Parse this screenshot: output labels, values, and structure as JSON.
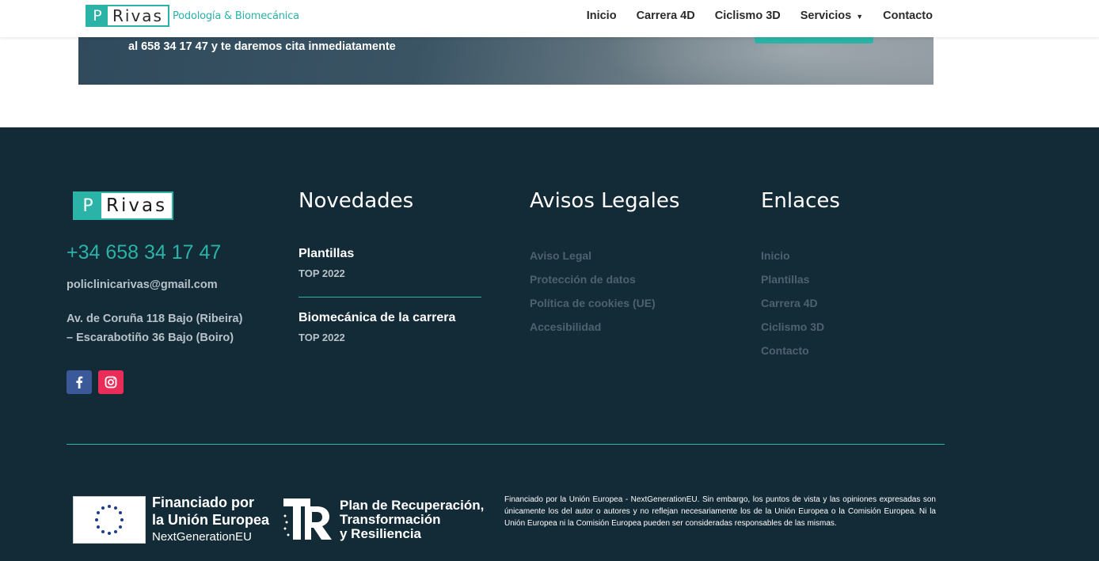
{
  "header": {
    "logo_letter": "P",
    "logo_name": "Rivas",
    "logo_tagline": "Podología & Biomecánica",
    "nav": [
      {
        "label": "Inicio"
      },
      {
        "label": "Carrera 4D"
      },
      {
        "label": "Ciclismo 3D"
      },
      {
        "label": "Servicios"
      },
      {
        "label": "Contacto"
      }
    ]
  },
  "hero": {
    "text": "al 658 34 17 47 y te daremos cita inmediatamente"
  },
  "footer": {
    "logo_letter": "P",
    "logo_name": "Rivas",
    "phone": "+34 658 34 17 47",
    "email": "policlinicarivas@gmail.com",
    "address_line1": "Av. de Coruña 118 Bajo (Ribeira)",
    "address_line2": "– Escarabotiño 36 Bajo (Boiro)",
    "news": {
      "title": "Novedades",
      "items": [
        {
          "title": "Plantillas",
          "meta": "TOP 2022"
        },
        {
          "title": "Biomecánica de la carrera",
          "meta": "TOP 2022"
        }
      ]
    },
    "legal": {
      "title": "Avisos Legales",
      "links": [
        "Aviso Legal",
        "Protección de datos",
        "Política de cookies (UE)",
        "Accesibilidad"
      ]
    },
    "links": {
      "title": "Enlaces",
      "links": [
        "Inicio",
        "Plantillas",
        "Carrera 4D",
        "Ciclismo 3D",
        "Contacto"
      ]
    },
    "eu": {
      "line1": "Financiado por",
      "line2": "la Unión Europea",
      "line3": "NextGenerationEU",
      "plan1": "Plan de Recuperación,",
      "plan2": "Transformación",
      "plan3": "y Resiliencia",
      "disclaimer": "Financiado por la Unión Europea - NextGenerationEU. Sin embargo, los puntos de vista y las opiniones expresadas son únicamente los del autor o autores y no reflejan necesariamente los de la Unión Europea o la Comisión Europea. Ni la Unión Europea ni la Comisión Europea pueden ser consideradas responsables de las mismas."
    }
  },
  "colors": {
    "accent": "#2ab3a6",
    "footer_bg": "#132a37",
    "facebook": "#3b5998",
    "instagram": "#ea2c59"
  }
}
